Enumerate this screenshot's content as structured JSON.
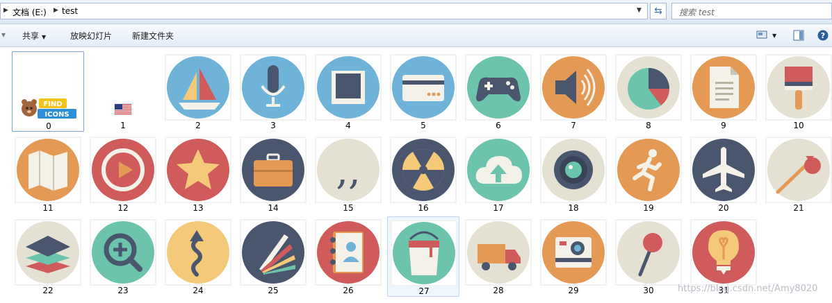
{
  "address": {
    "segments": [
      "文档 (E:)",
      "test"
    ]
  },
  "search": {
    "placeholder": "搜索 test"
  },
  "toolbar": {
    "share_label": "共享",
    "slideshow_label": "放映幻灯片",
    "new_folder_label": "新建文件夹"
  },
  "files": [
    {
      "name": "0",
      "icon": "find-icons-logo"
    },
    {
      "name": "1",
      "icon": "us-flag"
    },
    {
      "name": "2",
      "icon": "sailboat",
      "bg": "#6fb3d8"
    },
    {
      "name": "3",
      "icon": "microphone",
      "bg": "#6fb3d8"
    },
    {
      "name": "4",
      "icon": "photo-frame",
      "bg": "#6fb3d8"
    },
    {
      "name": "5",
      "icon": "credit-card",
      "bg": "#6fb3d8"
    },
    {
      "name": "6",
      "icon": "gamepad",
      "bg": "#6cc4ad"
    },
    {
      "name": "7",
      "icon": "speaker",
      "bg": "#e49a55"
    },
    {
      "name": "8",
      "icon": "pie-chart",
      "bg": "#e4e1d3"
    },
    {
      "name": "9",
      "icon": "document",
      "bg": "#e49a55"
    },
    {
      "name": "10",
      "icon": "paint-brush",
      "bg": "#e4e1d3"
    },
    {
      "name": "11",
      "icon": "map",
      "bg": "#e49a55"
    },
    {
      "name": "12",
      "icon": "play",
      "bg": "#cf5b5b"
    },
    {
      "name": "13",
      "icon": "star",
      "bg": "#cf5b5b"
    },
    {
      "name": "14",
      "icon": "briefcase",
      "bg": "#4a566e"
    },
    {
      "name": "15",
      "icon": "quote",
      "bg": "#e4e1d3"
    },
    {
      "name": "16",
      "icon": "radiation",
      "bg": "#4a566e"
    },
    {
      "name": "17",
      "icon": "cloud-upload",
      "bg": "#6cc4ad"
    },
    {
      "name": "18",
      "icon": "camera-lens",
      "bg": "#e4e1d3"
    },
    {
      "name": "19",
      "icon": "running-man",
      "bg": "#e49a55"
    },
    {
      "name": "20",
      "icon": "airplane",
      "bg": "#4a566e"
    },
    {
      "name": "21",
      "icon": "bindle",
      "bg": "#e4e1d3"
    },
    {
      "name": "22",
      "icon": "layers",
      "bg": "#e4e1d3"
    },
    {
      "name": "23",
      "icon": "zoom-in",
      "bg": "#6cc4ad"
    },
    {
      "name": "24",
      "icon": "winding-arrow",
      "bg": "#f4c97a"
    },
    {
      "name": "25",
      "icon": "color-swatches",
      "bg": "#4a566e"
    },
    {
      "name": "26",
      "icon": "address-book",
      "bg": "#cf5b5b"
    },
    {
      "name": "27",
      "icon": "paint-bucket",
      "bg": "#6cc4ad"
    },
    {
      "name": "28",
      "icon": "truck",
      "bg": "#e4e1d3"
    },
    {
      "name": "29",
      "icon": "instant-camera",
      "bg": "#e49a55"
    },
    {
      "name": "30",
      "icon": "pin",
      "bg": "#e4e1d3"
    },
    {
      "name": "31",
      "icon": "lightbulb",
      "bg": "#cf5b5b"
    }
  ],
  "watermark": "https://blog.csdn.net/Amy8020"
}
